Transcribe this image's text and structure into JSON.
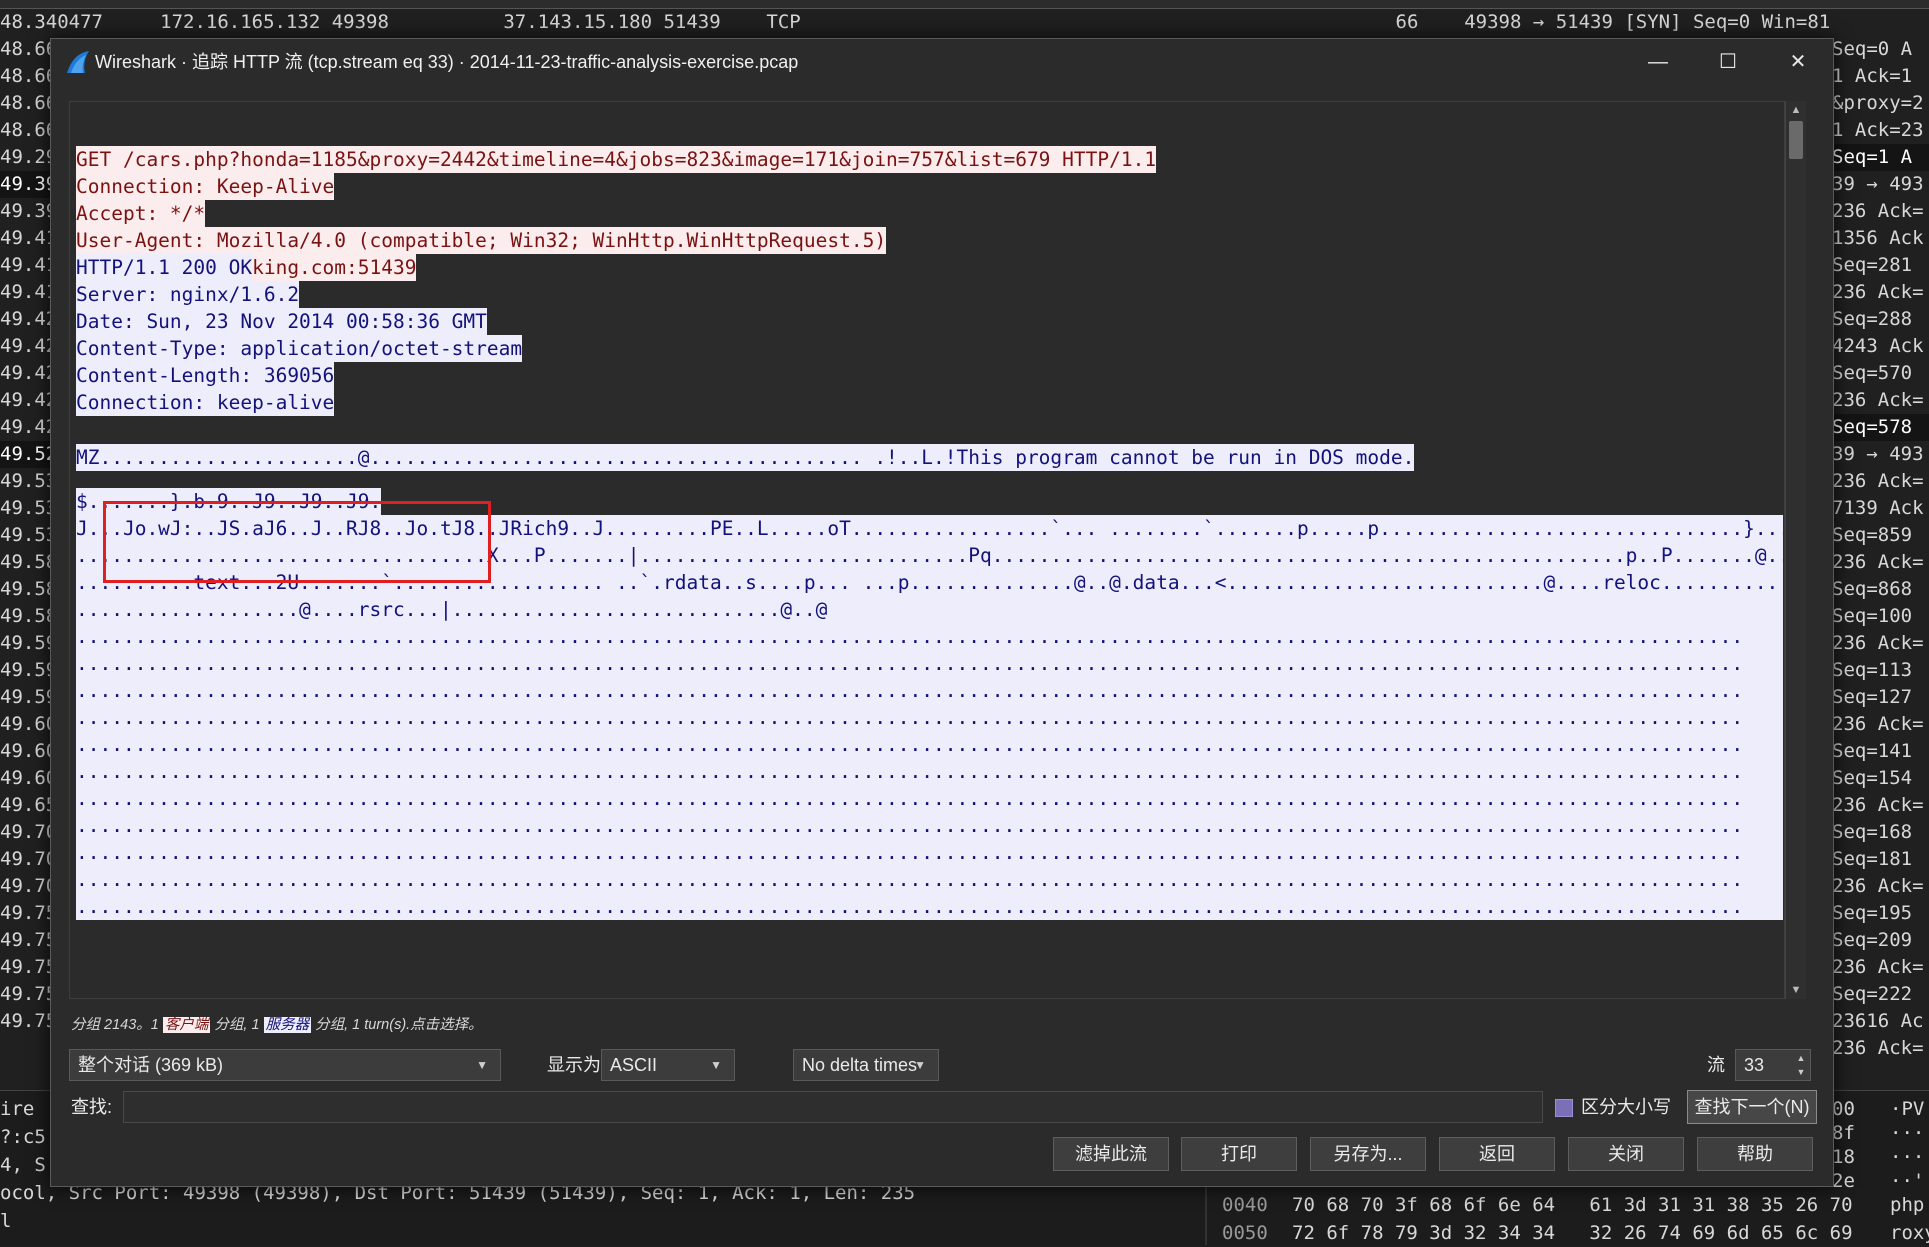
{
  "background": {
    "top_row": "48.340477     172.16.165.132 49398          37.143.15.180 51439    TCP                                                    66    49398 → 51439 [SYN] Seq=0 Win=81",
    "left_col": [
      "48.66",
      "48.66",
      "48.66",
      "48.66",
      "49.29",
      "49.39",
      "49.39",
      "49.41",
      "49.41",
      "49.41",
      "49.42",
      "49.42",
      "49.42",
      "49.42",
      "49.42",
      "49.52",
      "49.53",
      "49.53",
      "49.53",
      "49.58",
      "49.58",
      "49.58",
      "49.59",
      "49.59",
      "49.59",
      "49.60",
      "49.60",
      "49.60",
      "49.65",
      "49.70",
      "49.70",
      "49.70",
      "49.75",
      "49.75",
      "49.75",
      "49.75",
      "49.75"
    ],
    "right_col": [
      "Seq=0 A",
      "1 Ack=1",
      "&proxy=2",
      "1 Ack=23",
      "Seq=1 A",
      "39 → 493",
      "236 Ack=",
      "1356 Ack",
      "Seq=281",
      "236 Ack=",
      "Seq=288",
      "4243 Ack",
      "Seq=570",
      "236 Ack=",
      "Seq=578",
      "39 → 493",
      "236 Ack=",
      "7139 Ack",
      "Seq=859",
      "236 Ack=",
      "Seq=868",
      "Seq=100",
      "236 Ack=",
      "Seq=113",
      "Seq=127",
      "236 Ack=",
      "Seq=141",
      "Seq=154",
      "236 Ack=",
      "Seq=168",
      "Seq=181",
      "236 Ack=",
      "Seq=195",
      "Seq=209",
      "236 Ack=",
      "Seq=222",
      "23616 Ac",
      "236 Ack="
    ],
    "bottom_left": [
      "ire",
      "?:c5:",
      "4, S",
      "ocol, Src Port: 49398 (49398), Dst Port: 51439 (51439), Seq: 1, Ack: 1, Len: 235",
      "l"
    ],
    "hex_rows": [
      {
        "offset": "0040",
        "hex": "70 68 70 3f 68 6f 6e 64   61 3d 31 31 38 35 26 70",
        "ascii": "php"
      },
      {
        "offset": "0050",
        "hex": "72 6f 78 79 3d 32 34 34   32 26 74 69 6d 65 6c 69",
        "ascii": "roxy"
      }
    ],
    "right_hex": [
      "00",
      "8f",
      "18",
      "2e"
    ],
    "right_ascii": [
      "·PV",
      "···",
      "···",
      "··'"
    ]
  },
  "dialog": {
    "title": "Wireshark · 追踪 HTTP 流 (tcp.stream eq 33) · 2014-11-23-traffic-analysis-exercise.pcap",
    "client_lines": [
      "GET /cars.php?honda=1185&proxy=2442&timeline=4&jobs=823&image=171&join=757&list=679 HTTP/1.1",
      "Connection: Keep-Alive",
      "Accept: */*",
      "User-Agent: Mozilla/4.0 (compatible; Win32; WinHttp.WinHttpRequest.5)",
      "Host: h.trinketking.com:51439"
    ],
    "server_header_lines": [
      "HTTP/1.1 200 OK",
      "Server: nginx/1.6.2",
      "Date: Sun, 23 Nov 2014 00:58:36 GMT",
      "Content-Type: application/octet-stream",
      "Content-Length: 369056",
      "Connection: keep-alive"
    ],
    "mz_line": "MZ......................@.......................................... .!..L.!This program cannot be run in DOS mode.",
    "short_line": "$.......}.b.9..J9..J9..J9.",
    "body_lines": [
      "J...Jo.wJ:..JS.aJ6..J..RJ8..Jo.tJ8..JRich9..J.........PE..L.....oT.................`... ........`.......p.....p...............................}...",
      "...................................X...P.......|............................Pq......................................................p..P.......@.........",
      "..........text...2U.......`.................. ..`.rdata..s....p... ...p..............@..@.data...<...........................@....reloc..........",
      "...................@....rsrc...|............................@..@",
      "..............................................................................................................................................",
      "..............................................................................................................................................",
      "..............................................................................................................................................",
      "..............................................................................................................................................",
      "..............................................................................................................................................",
      "..............................................................................................................................................",
      "..............................................................................................................................................",
      "..............................................................................................................................................",
      "..............................................................................................................................................",
      "..............................................................................................................................................",
      ".............................................................................................................................................."
    ],
    "status": {
      "prefix": "分组 2143。1 ",
      "client_tag": "客户端",
      "mid": " 分组, 1 ",
      "server_tag": "服务器",
      "suffix": " 分组, 1 turn(s).点击选择。"
    },
    "conversation_select": "整个对话 (369 kB)",
    "show_as_label": "显示为",
    "show_as_value": "ASCII",
    "delta_select": "No delta times",
    "stream_label": "流",
    "stream_value": "33",
    "find_label": "查找:",
    "case_label": "区分大小写",
    "buttons": {
      "find_next": "查找下一个(N)",
      "filter_out": "滤掉此流",
      "print": "打印",
      "save_as": "另存为...",
      "back": "返回",
      "close": "关闭",
      "help": "帮助"
    },
    "colors": {
      "client_bg": "#fbeded",
      "client_fg": "#7a1212",
      "server_bg": "#ededfb",
      "server_fg": "#13127a",
      "highlight_box": "#e02020"
    }
  }
}
